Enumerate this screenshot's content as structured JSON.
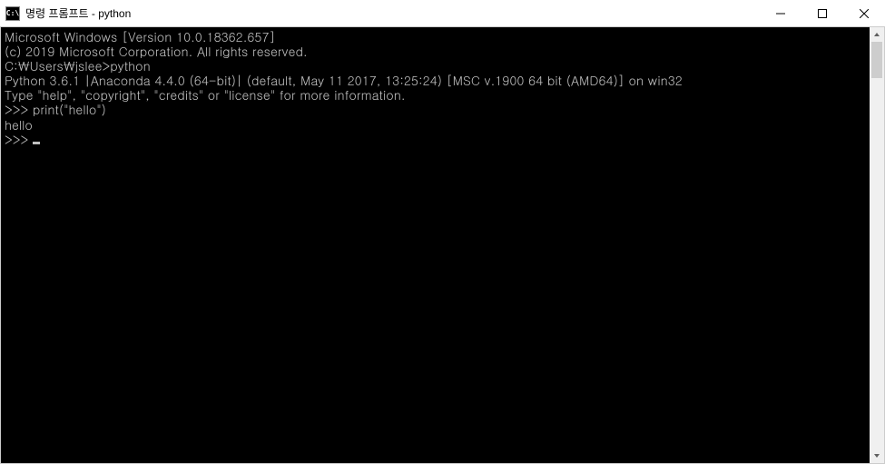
{
  "window": {
    "title": "명령 프롬프트 - python",
    "icon_label": "C:\\"
  },
  "terminal": {
    "lines": [
      "Microsoft Windows [Version 10.0.18362.657]",
      "(c) 2019 Microsoft Corporation. All rights reserved.",
      "",
      "C:\\Users\\jslee>python",
      "Python 3.6.1 |Anaconda 4.4.0 (64-bit)| (default, May 11 2017, 13:25:24) [MSC v.1900 64 bit (AMD64)] on win32",
      "Type \"help\", \"copyright\", \"credits\" or \"license\" for more information.",
      ">>> print(\"hello\")",
      "hello",
      ">>> "
    ]
  }
}
